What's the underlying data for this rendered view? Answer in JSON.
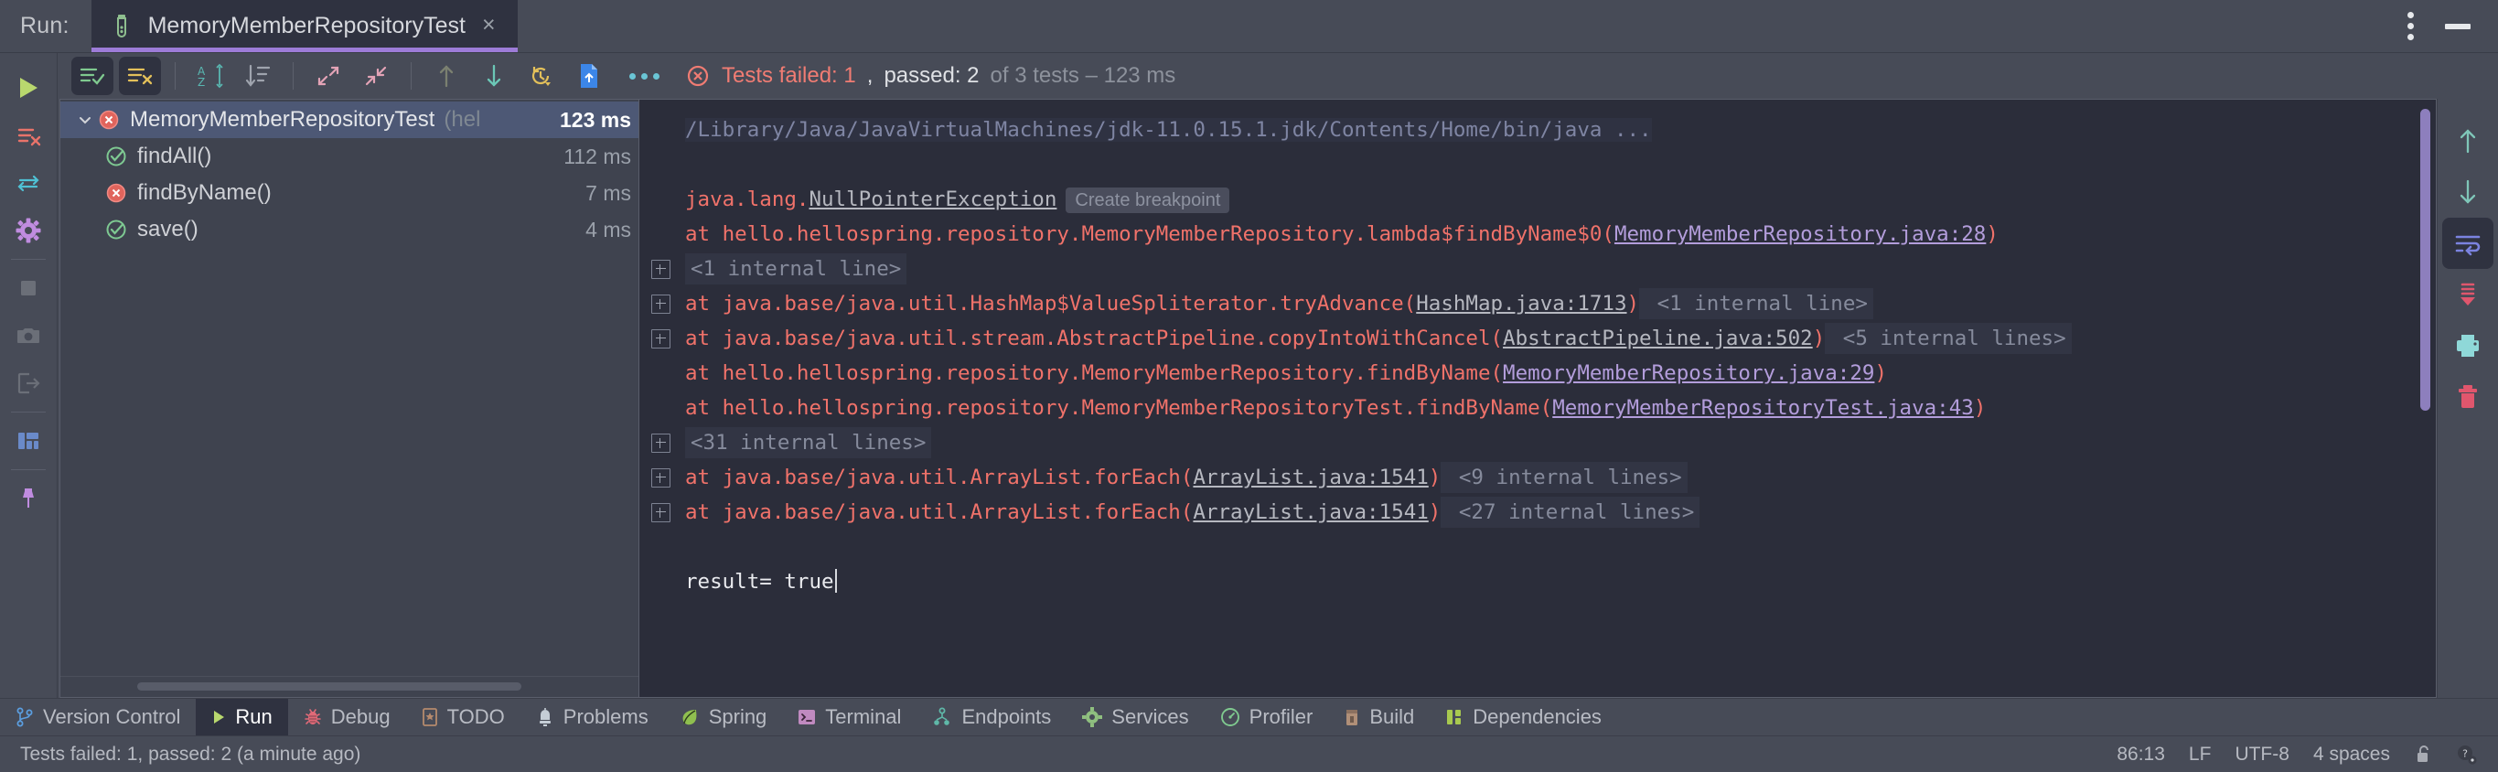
{
  "window": {
    "run_label": "Run:",
    "tab_title": "MemoryMemberRepositoryTest",
    "tab_close": "×"
  },
  "toolbar": {
    "buttons": [
      {
        "name": "show-passed-tests",
        "icon": "list-check-icon",
        "active": true
      },
      {
        "name": "show-failed-tests",
        "icon": "list-x-icon",
        "active": true
      },
      {
        "name": "sort-alphabetically",
        "icon": "sort-az-icon",
        "active": false
      },
      {
        "name": "sort-by-duration",
        "icon": "sort-duration-icon",
        "active": false
      },
      {
        "name": "expand-all",
        "icon": "expand-icon",
        "active": false
      },
      {
        "name": "collapse-all",
        "icon": "collapse-icon",
        "active": false
      },
      {
        "name": "previous-failed-test",
        "icon": "arrow-up-icon",
        "active": false
      },
      {
        "name": "next-failed-test",
        "icon": "arrow-down-icon",
        "active": false
      },
      {
        "name": "test-history",
        "icon": "history-clock-icon",
        "active": false
      },
      {
        "name": "export-test-results",
        "icon": "export-file-icon",
        "active": false
      }
    ],
    "more_options": "more-options-icon"
  },
  "test_status": {
    "failed_prefix": "Tests failed: ",
    "failed_count": "1",
    "comma": ", ",
    "passed_prefix": "passed: ",
    "passed_count": "2",
    "of_tests": " of 3 tests – 123 ms"
  },
  "left_rail": [
    {
      "name": "rerun-button",
      "icon": "run-play-icon"
    },
    {
      "name": "rerun-failed-tests-button",
      "icon": "rerun-failed-icon"
    },
    {
      "name": "toggle-auto-test-button",
      "icon": "auto-test-arrows-icon"
    },
    {
      "name": "configure-settings-button",
      "icon": "gear-icon"
    },
    {
      "name": "stop-button",
      "icon": "stop-square-icon"
    },
    {
      "name": "capture-memory-snapshot-button",
      "icon": "camera-icon"
    },
    {
      "name": "dump-threads-button",
      "icon": "thread-dump-icon"
    },
    {
      "name": "layout-settings-button",
      "icon": "layout-icon"
    },
    {
      "name": "pin-tab-button",
      "icon": "pin-icon"
    }
  ],
  "tests": {
    "tree": [
      {
        "name": "MemoryMemberRepositoryTest",
        "package": "(hel",
        "duration": "123 ms",
        "status": "failed",
        "level": 0,
        "selected": true,
        "expanded": true
      },
      {
        "name": "findAll()",
        "package": "",
        "duration": "112 ms",
        "status": "passed",
        "level": 1,
        "selected": false
      },
      {
        "name": "findByName()",
        "package": "",
        "duration": "7 ms",
        "status": "failed",
        "level": 1,
        "selected": false
      },
      {
        "name": "save()",
        "package": "",
        "duration": "4 ms",
        "status": "passed",
        "level": 1,
        "selected": false
      }
    ]
  },
  "console": {
    "lines": [
      {
        "type": "path",
        "text": "/Library/Java/JavaVirtualMachines/jdk-11.0.15.1.jdk/Contents/Home/bin/java ..."
      },
      {
        "type": "blank",
        "text": ""
      },
      {
        "type": "exception",
        "pre": "java.lang.",
        "link": "NullPointerException",
        "badge": "Create breakpoint"
      },
      {
        "type": "stack",
        "fold": false,
        "pre": "    at hello.hellospring.repository.MemoryMemberRepository.lambda$findByName$0(",
        "link": "MemoryMemberRepository.java:28",
        "post": ")",
        "tail": ""
      },
      {
        "type": "internal",
        "fold": true,
        "text": "    <1 internal line>"
      },
      {
        "type": "stack",
        "fold": true,
        "pre": "    at java.base/java.util.HashMap$ValueSpliterator.tryAdvance(",
        "link": "HashMap.java:1713",
        "post": ")",
        "tail": " <1 internal line>"
      },
      {
        "type": "stack",
        "fold": true,
        "pre": "    at java.base/java.util.stream.AbstractPipeline.copyIntoWithCancel(",
        "link": "AbstractPipeline.java:502",
        "post": ")",
        "tail": " <5 internal lines>"
      },
      {
        "type": "stack",
        "fold": false,
        "pre": "    at hello.hellospring.repository.MemoryMemberRepository.findByName(",
        "link": "MemoryMemberRepository.java:29",
        "post": ")",
        "tail": ""
      },
      {
        "type": "stack",
        "fold": false,
        "pre": "    at hello.hellospring.repository.MemoryMemberRepositoryTest.findByName(",
        "link": "MemoryMemberRepositoryTest.java:43",
        "post": ")",
        "tail": ""
      },
      {
        "type": "internal",
        "fold": true,
        "text": "    <31 internal lines>"
      },
      {
        "type": "stack",
        "fold": true,
        "pre": "    at java.base/java.util.ArrayList.forEach(",
        "link": "ArrayList.java:1541",
        "post": ")",
        "tail": " <9 internal lines>"
      },
      {
        "type": "stack",
        "fold": true,
        "pre": "    at java.base/java.util.ArrayList.forEach(",
        "link": "ArrayList.java:1541",
        "post": ")",
        "tail": " <27 internal lines>"
      },
      {
        "type": "blank",
        "text": ""
      },
      {
        "type": "result",
        "text": "result= true"
      }
    ]
  },
  "right_rail": [
    {
      "name": "scroll-up-button",
      "icon": "arrow-up-icon",
      "active": false
    },
    {
      "name": "scroll-down-button",
      "icon": "arrow-down-icon",
      "active": false
    },
    {
      "name": "soft-wrap-button",
      "icon": "soft-wrap-icon",
      "active": true
    },
    {
      "name": "scroll-to-end-button",
      "icon": "scroll-to-end-icon",
      "active": false
    },
    {
      "name": "print-button",
      "icon": "printer-icon",
      "active": false
    },
    {
      "name": "clear-all-button",
      "icon": "trash-icon",
      "active": false
    }
  ],
  "tool_windows": [
    {
      "label": "Version Control",
      "icon": "branch-icon",
      "active": false
    },
    {
      "label": "Run",
      "icon": "play-icon",
      "active": true
    },
    {
      "label": "Debug",
      "icon": "bug-icon",
      "active": false
    },
    {
      "label": "TODO",
      "icon": "todo-icon",
      "active": false
    },
    {
      "label": "Problems",
      "icon": "problems-icon",
      "active": false
    },
    {
      "label": "Spring",
      "icon": "spring-leaf-icon",
      "active": false
    },
    {
      "label": "Terminal",
      "icon": "terminal-icon",
      "active": false
    },
    {
      "label": "Endpoints",
      "icon": "endpoints-icon",
      "active": false
    },
    {
      "label": "Services",
      "icon": "services-gear-icon",
      "active": false
    },
    {
      "label": "Profiler",
      "icon": "profiler-icon",
      "active": false
    },
    {
      "label": "Build",
      "icon": "build-icon",
      "active": false
    },
    {
      "label": "Dependencies",
      "icon": "dependencies-icon",
      "active": false
    }
  ],
  "statusbar": {
    "message": "Tests failed: 1, passed: 2 (a minute ago)",
    "caret_position": "86:13",
    "line_separator": "LF",
    "encoding": "UTF-8",
    "indent": "4 spaces",
    "lock_icon": "unlocked-padlock-icon",
    "help_icon": "help-settings-icon"
  },
  "colors": {
    "accent_purple": "#9d7cd8",
    "error_red": "#f07c73",
    "success_green": "#7ec992",
    "panel_bg": "#474b57",
    "console_bg": "#2b2d3a"
  }
}
